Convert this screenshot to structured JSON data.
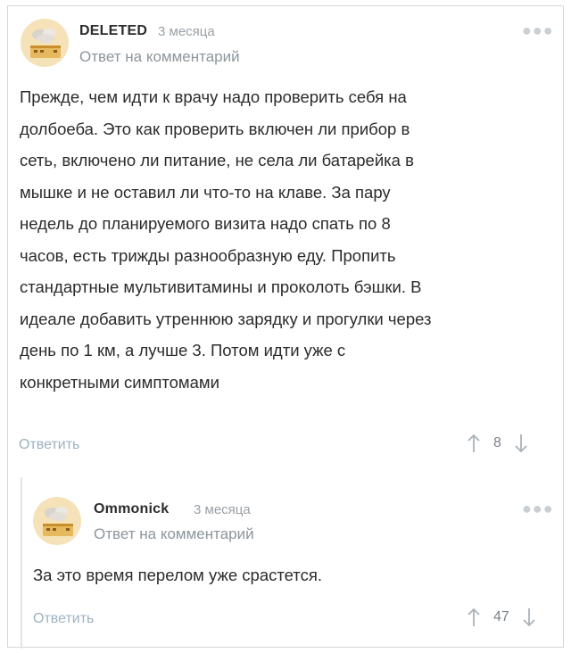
{
  "comments": [
    {
      "author": "DELETED",
      "time": "3 месяца",
      "reply_prefix": "Ответ на",
      "reply_link": "комментарий",
      "more_icon": "more-dots-icon",
      "lines": [
        "Прежде, чем идти к врачу надо проверить себя на",
        "долбоеба. Это как проверить включен ли прибор в",
        "сеть, включено ли питание, не села ли батарейка в",
        "мышке и не оставил ли что-то на клаве. За пару",
        "недель до планируемого визита надо спать по 8",
        "часов, есть трижды разнообразную еду. Пропить",
        "стандартные мультивитамины и проколоть бэшки. В",
        "идеале добавить утреннюю зарядку и прогулки через",
        "день по 1 км, а лучше 3. Потом идти уже с",
        "конкретными симптомами"
      ],
      "reply_label": "Ответить",
      "votes": "8"
    },
    {
      "author": "Ommonick",
      "time": "3 месяца",
      "reply_prefix": "Ответ на",
      "reply_link": "комментарий",
      "more_icon": "more-dots-icon",
      "lines": [
        "За это время перелом уже срастется."
      ],
      "reply_label": "Ответить",
      "votes": "47"
    }
  ],
  "colors": {
    "link": "#9db2bf",
    "muted": "#8d969c",
    "border": "#d6d6d6"
  }
}
